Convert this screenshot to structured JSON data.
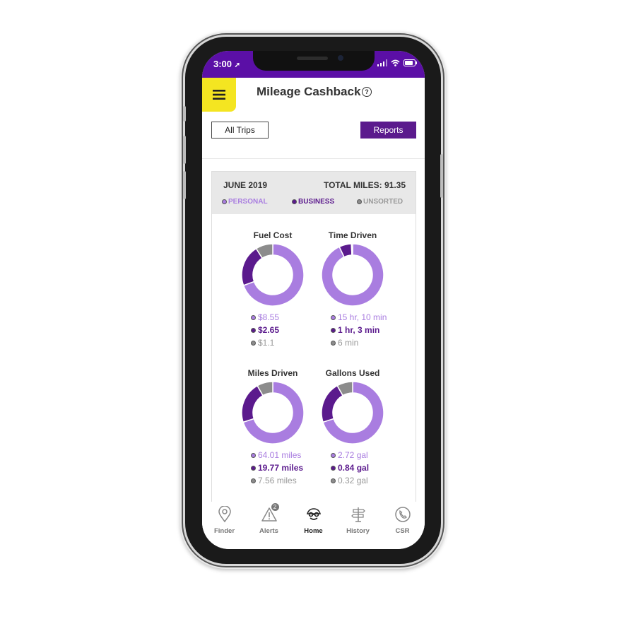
{
  "status_bar": {
    "time": "3:00"
  },
  "header": {
    "title": "Mileage Cashback",
    "help": "?"
  },
  "buttons": {
    "all_trips": "All Trips",
    "reports": "Reports"
  },
  "summary": {
    "month": "JUNE 2019",
    "total_miles": "TOTAL MILES: 91.35",
    "legend": [
      {
        "label": "PERSONAL",
        "color": "#a97de0"
      },
      {
        "label": "BUSINESS",
        "color": "#5b1a8d"
      },
      {
        "label": "UNSORTED",
        "color": "#8c8c8c"
      }
    ]
  },
  "colors": {
    "personal": "#a97de0",
    "business": "#5b1a8d",
    "unsorted": "#8c8c8c",
    "status_bar": "#5b0fa6",
    "menu": "#f4e521"
  },
  "chart_data": [
    {
      "type": "pie",
      "title": "Fuel Cost",
      "categories": [
        "Personal",
        "Business",
        "Unsorted"
      ],
      "values": [
        8.55,
        2.65,
        1.1
      ],
      "labels": [
        "$8.55",
        "$2.65",
        "$1.1"
      ]
    },
    {
      "type": "pie",
      "title": "Time Driven",
      "categories": [
        "Personal",
        "Business",
        "Unsorted"
      ],
      "values": [
        910,
        63,
        6
      ],
      "labels": [
        "15 hr, 10 min",
        "1 hr, 3 min",
        "6 min"
      ]
    },
    {
      "type": "pie",
      "title": "Miles Driven",
      "categories": [
        "Personal",
        "Business",
        "Unsorted"
      ],
      "values": [
        64.01,
        19.77,
        7.56
      ],
      "labels": [
        "64.01 miles",
        "19.77 miles",
        "7.56 miles"
      ]
    },
    {
      "type": "pie",
      "title": "Gallons Used",
      "categories": [
        "Personal",
        "Business",
        "Unsorted"
      ],
      "values": [
        2.72,
        0.84,
        0.32
      ],
      "labels": [
        "2.72 gal",
        "0.84 gal",
        "0.32 gal"
      ]
    }
  ],
  "nav": [
    {
      "label": "Finder",
      "icon": "location-pin-icon"
    },
    {
      "label": "Alerts",
      "icon": "alert-icon",
      "badge": "2"
    },
    {
      "label": "Home",
      "icon": "car-icon",
      "active": true
    },
    {
      "label": "History",
      "icon": "signpost-icon"
    },
    {
      "label": "CSR",
      "icon": "phone-icon"
    }
  ]
}
